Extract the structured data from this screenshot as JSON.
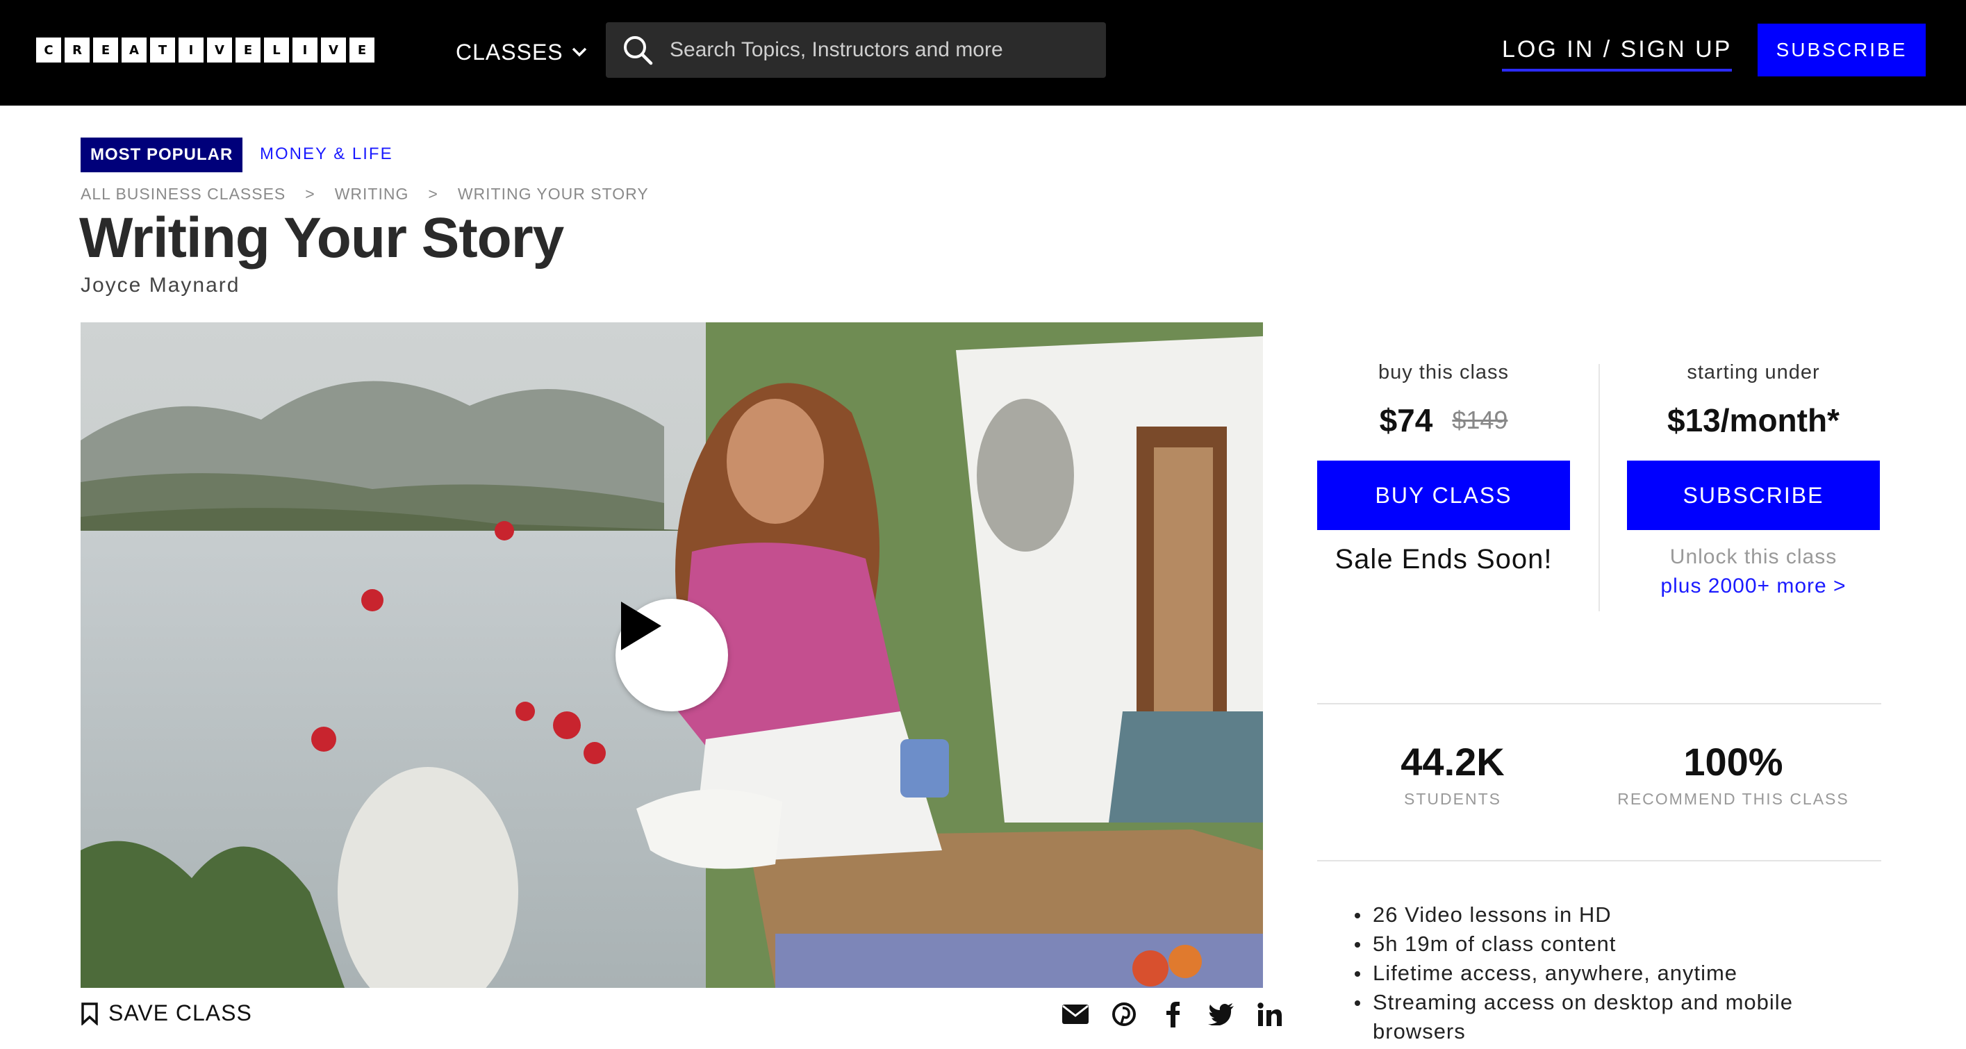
{
  "header": {
    "logo_letters": [
      "C",
      "R",
      "E",
      "A",
      "T",
      "I",
      "V",
      "E",
      "L",
      "I",
      "V",
      "E"
    ],
    "classes_label": "CLASSES",
    "search_placeholder": "Search Topics, Instructors and more",
    "login_label": "LOG IN / SIGN UP",
    "subscribe_label": "SUBSCRIBE"
  },
  "badge": "MOST POPULAR",
  "category": "MONEY & LIFE",
  "breadcrumb": [
    "ALL BUSINESS CLASSES",
    ">",
    "WRITING",
    ">",
    "WRITING YOUR STORY"
  ],
  "title": "Writing Your Story",
  "author": "Joyce Maynard",
  "save_label": "SAVE CLASS",
  "share_icons": [
    "email-icon",
    "pinterest-icon",
    "facebook-icon",
    "twitter-icon",
    "linkedin-icon"
  ],
  "buy": {
    "label": "buy this class",
    "price": "$74",
    "old_price": "$149",
    "button": "BUY CLASS",
    "note": "Sale Ends Soon!"
  },
  "subscribe": {
    "label": "starting under",
    "price": "$13/month*",
    "button": "SUBSCRIBE",
    "note": "Unlock this class",
    "link": "plus 2000+ more >"
  },
  "stats": [
    {
      "value": "44.2K",
      "caption": "STUDENTS"
    },
    {
      "value": "100%",
      "caption": "RECOMMEND THIS CLASS"
    }
  ],
  "features": [
    "26 Video lessons in HD",
    "5h 19m of class content",
    "Lifetime access, anywhere, anytime",
    "Streaming access on desktop and mobile browsers"
  ],
  "colors": {
    "accent": "#0000ff",
    "badge": "#00007a",
    "header": "#000000"
  }
}
